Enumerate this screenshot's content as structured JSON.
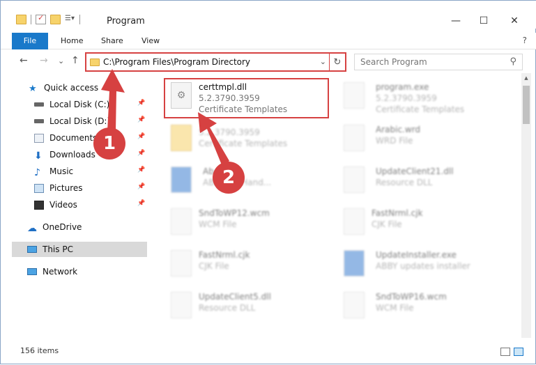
{
  "window": {
    "title": "Program",
    "minimize_glyph": "—",
    "maximize_glyph": "☐",
    "close_glyph": "✕"
  },
  "ribbon": {
    "tabs": [
      "File",
      "Home",
      "Share",
      "View"
    ],
    "help_glyph": "?"
  },
  "nav": {
    "back_glyph": "←",
    "forward_glyph": "→",
    "recent_glyph": "⌄",
    "up_glyph": "↑",
    "address_path": "C:\\Program Files\\Program Directory",
    "search_placeholder": "Search Program"
  },
  "sidebar": {
    "items": [
      {
        "label": "Quick access",
        "icon": "star-icon",
        "pinned": false
      },
      {
        "label": "Local Disk (C:)",
        "icon": "drive-icon",
        "pinned": true
      },
      {
        "label": "Local Disk (D:)",
        "icon": "drive-icon",
        "pinned": true
      },
      {
        "label": "Documents",
        "icon": "documents-icon",
        "pinned": true
      },
      {
        "label": "Downloads",
        "icon": "download-icon",
        "pinned": true
      },
      {
        "label": "Music",
        "icon": "music-icon",
        "pinned": true
      },
      {
        "label": "Pictures",
        "icon": "pictures-icon",
        "pinned": true
      },
      {
        "label": "Videos",
        "icon": "videos-icon",
        "pinned": true
      },
      {
        "label": "OneDrive",
        "icon": "cloud-icon",
        "pinned": false
      },
      {
        "label": "This PC",
        "icon": "computer-icon",
        "pinned": false,
        "selected": true
      },
      {
        "label": "Network",
        "icon": "network-icon",
        "pinned": false
      }
    ]
  },
  "files": [
    {
      "name": "certtmpl.dll",
      "line2": "5.2.3790.3959",
      "line3": "Certificate Templates",
      "highlighted": true
    },
    {
      "name": "program.exe",
      "line2": "5.2.3790.3959",
      "line3": "Certificate Templates"
    },
    {
      "name": "",
      "line2": "5.2.3790.3959",
      "line3": "Certificate Templates"
    },
    {
      "name": "Arabic.wrd",
      "line2": "WRD File",
      "line3": ""
    },
    {
      "name": "Ab...exe",
      "line2": "AB... ent Hand...",
      "line3": ""
    },
    {
      "name": "UpdateClient21.dll",
      "line2": "Resource DLL",
      "line3": ""
    },
    {
      "name": "SndToWP12.wcm",
      "line2": "WCM File",
      "line3": ""
    },
    {
      "name": "FastNrml.cjk",
      "line2": "CJK File",
      "line3": ""
    },
    {
      "name": "FastNrml.cjk",
      "line2": "CJK File",
      "line3": ""
    },
    {
      "name": "UpdateInstaller.exe",
      "line2": "ABBY updates installer",
      "line3": ""
    },
    {
      "name": "UpdateClient5.dll",
      "line2": "Resource DLL",
      "line3": ""
    },
    {
      "name": "SndToWP16.wcm",
      "line2": "WCM File",
      "line3": ""
    }
  ],
  "status": {
    "item_count": "156 items"
  },
  "callouts": [
    "1",
    "2"
  ],
  "colors": {
    "accent": "#1979ca",
    "highlight": "#d64141"
  }
}
